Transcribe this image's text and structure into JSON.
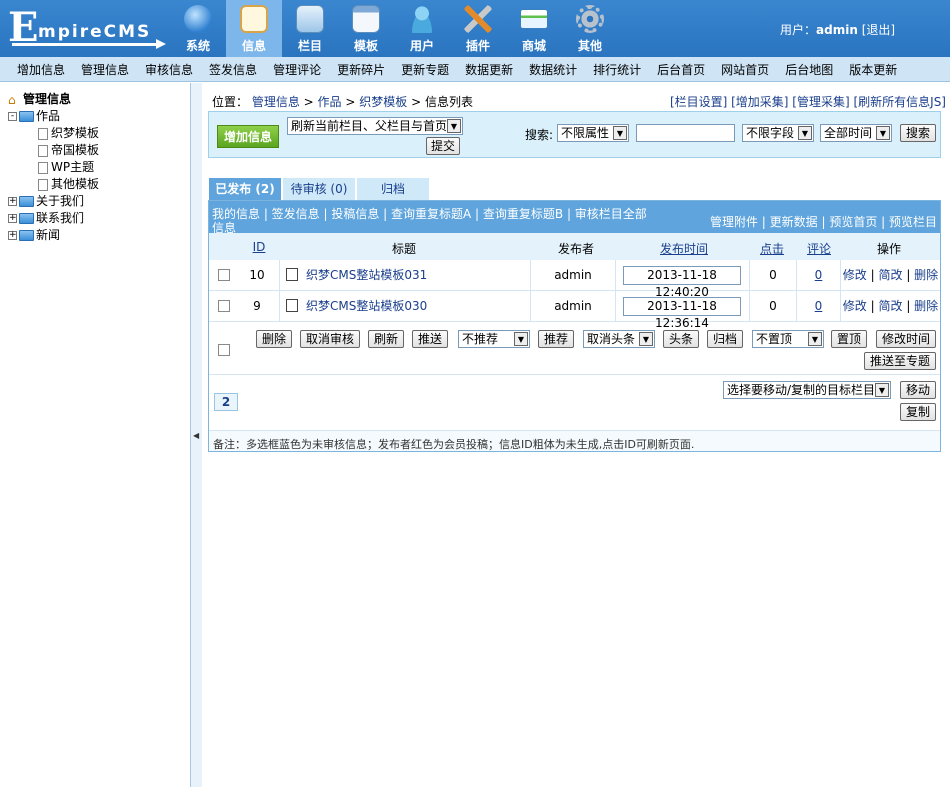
{
  "logo": {
    "big": "E",
    "text": "mpireCMS"
  },
  "topnav": [
    {
      "label": "系统",
      "icon": "globe-icon",
      "color": "#2e7fd0"
    },
    {
      "label": "信息",
      "icon": "notepad-icon",
      "color": "#f4d38c"
    },
    {
      "label": "栏目",
      "icon": "folder-icon",
      "color": "#c7dff2"
    },
    {
      "label": "模板",
      "icon": "window-icon",
      "color": "#dce9f6"
    },
    {
      "label": "用户",
      "icon": "user-icon",
      "color": "#6cc0ea"
    },
    {
      "label": "插件",
      "icon": "tools-icon",
      "color": "#e38b2b"
    },
    {
      "label": "商城",
      "icon": "card-icon",
      "color": "#5fc14b"
    },
    {
      "label": "其他",
      "icon": "gear-icon",
      "color": "#9aa6b2"
    }
  ],
  "user": {
    "prefix": "用户：",
    "name": "admin",
    "logout": "[退出]"
  },
  "menu": [
    "增加信息",
    "管理信息",
    "审核信息",
    "签发信息",
    "管理评论",
    "更新碎片",
    "更新专题",
    "数据更新",
    "数据统计",
    "排行统计",
    "后台首页",
    "网站首页",
    "后台地图",
    "版本更新"
  ],
  "tree": {
    "root": "管理信息",
    "works": "作品",
    "children": [
      "织梦模板",
      "帝国模板",
      "WP主题",
      "其他模板"
    ],
    "others": [
      "关于我们",
      "联系我们",
      "新闻"
    ]
  },
  "position": {
    "label": "位置：",
    "crumbs": [
      "管理信息",
      "作品",
      "织梦模板"
    ],
    "last": "信息列表"
  },
  "toplinks": "[栏目设置] [增加采集] [管理采集] [刷新所有信息JS]",
  "toolbar": {
    "add": "增加信息",
    "refresh_select": "刷新当前栏目、父栏目与首页",
    "submit": "提交",
    "search_label": "搜索:",
    "attr_select": "不限属性",
    "field_select": "不限字段",
    "time_select": "全部时间",
    "search_btn": "搜索"
  },
  "tabs": [
    {
      "label": "已发布 (2)"
    },
    {
      "label": "待审核 (0)"
    },
    {
      "label": "归档"
    }
  ],
  "panel": {
    "left_links": "我的信息 | 签发信息 | 投稿信息 | 查询重复标题A | 查询重复标题B | 审核栏目全部信息",
    "right_links": "管理附件 | 更新数据 | 预览首页 | 预览栏目"
  },
  "table": {
    "headers": {
      "id": "ID",
      "title": "标题",
      "author": "发布者",
      "time": "发布时间",
      "hits": "点击",
      "comments": "评论",
      "ops": "操作"
    },
    "rows": [
      {
        "id": "10",
        "title": "织梦CMS整站模板031",
        "author": "admin",
        "time": "2013-11-18 12:40:20",
        "hits": "0",
        "comments": "0"
      },
      {
        "id": "9",
        "title": "织梦CMS整站模板030",
        "author": "admin",
        "time": "2013-11-18 12:36:14",
        "hits": "0",
        "comments": "0"
      }
    ],
    "ops": {
      "edit": "修改",
      "simple": "简改",
      "delete": "删除"
    }
  },
  "actions": {
    "delete": "删除",
    "cancel_audit": "取消审核",
    "refresh": "刷新",
    "push": "推送",
    "recommend_select": "不推荐",
    "recommend": "推荐",
    "headline_select": "取消头条",
    "headline": "头条",
    "archive": "归档",
    "top_select": "不置顶",
    "top": "置顶",
    "modify_time": "修改时间",
    "push_topic": "推送至专题"
  },
  "pager": "2",
  "move": {
    "select": "选择要移动/复制的目标栏目",
    "move": "移动",
    "copy": "复制"
  },
  "note": "备注：多选框蓝色为未审核信息；发布者红色为会员投稿；信息ID粗体为未生成,点击ID可刷新页面."
}
